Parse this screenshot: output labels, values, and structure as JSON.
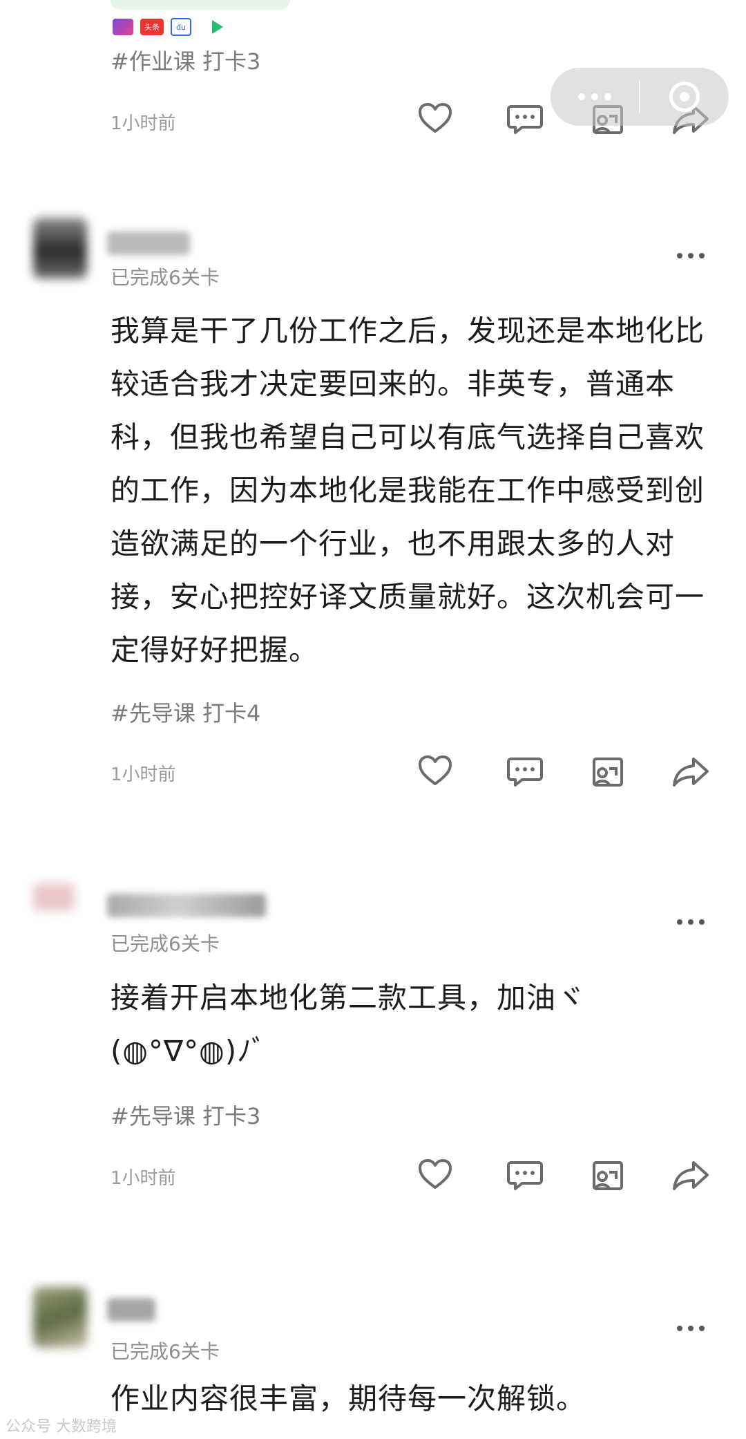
{
  "top_post": {
    "tag": "#作业课 打卡3",
    "time": "1小时前",
    "app_icons": [
      "youku-icon",
      "toutiao-icon",
      "baidu-icon",
      "play-icon"
    ],
    "toutiao_label": "头条",
    "baidu_label": "du"
  },
  "posts": [
    {
      "status": "已完成6关卡",
      "text": "我算是干了几份工作之后，发现还是本地化比较适合我才决定要回来的。非英专，普通本科，但我也希望自己可以有底气选择自己喜欢的工作，因为本地化是我能在工作中感受到创造欲满足的一个行业，也不用跟太多的人对接，安心把控好译文质量就好。这次机会可一定得好好把握。",
      "tag": "#先导课 打卡4",
      "time": "1小时前"
    },
    {
      "status": "已完成6关卡",
      "text": "接着开启本地化第二款工具，加油ヾ(◍°∇°◍)ﾉﾞ",
      "tag": "#先导课 打卡3",
      "time": "1小时前"
    },
    {
      "status": "已完成6关卡",
      "text": "作业内容很丰富，期待每一次解锁。"
    }
  ],
  "action_icons": [
    "heart-icon",
    "comment-icon",
    "share-card-icon",
    "forward-icon"
  ],
  "capsule": {
    "left_icon": "more-dots-icon",
    "right_icon": "close-target-icon"
  },
  "watermark": "公众号 大数跨境",
  "colors": {
    "text": "#1c1c1c",
    "meta": "#8f8f8f",
    "icon": "#6b6b6b"
  }
}
